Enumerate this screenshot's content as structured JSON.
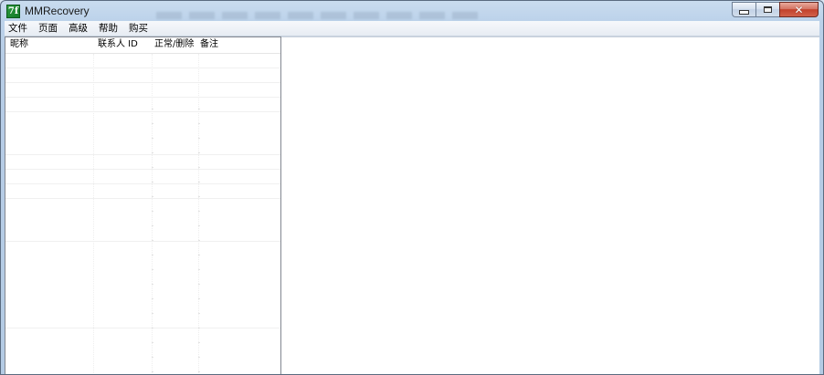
{
  "window": {
    "title": "MMRecovery",
    "icon_glyph": "7f",
    "icon_name": "mmrecovery-app-icon",
    "controls": {
      "minimize": "minimize-icon",
      "maximize": "maximize-icon",
      "close": "close-icon",
      "close_glyph": "✕"
    }
  },
  "menu": {
    "items": [
      {
        "label": "文件"
      },
      {
        "label": "页面"
      },
      {
        "label": "高级"
      },
      {
        "label": "帮助"
      },
      {
        "label": "购买"
      }
    ]
  },
  "contacts_list": {
    "columns": [
      {
        "label": "昵称"
      },
      {
        "label": "联系人 ID"
      },
      {
        "label": "正常/删除"
      },
      {
        "label": "备注"
      }
    ],
    "rows": []
  },
  "detail_pane": {
    "content": ""
  },
  "colors": {
    "frame": "#b7cde6",
    "close_button": "#c2412b",
    "icon_green": "#1e8a33",
    "pane_border": "#828790"
  }
}
